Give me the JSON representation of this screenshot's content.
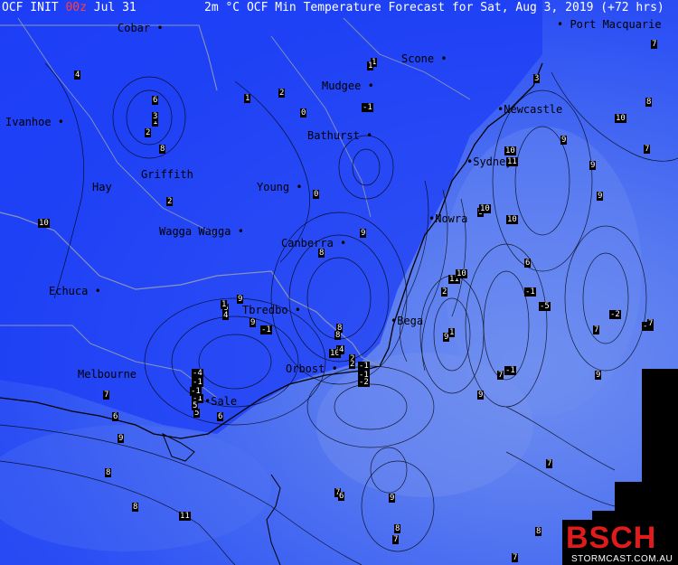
{
  "header": {
    "init_prefix": "OCF INIT ",
    "init_hour": "00z",
    "init_date": " Jul 31",
    "title": "2m °C OCF Min Temperature Forecast for Sat, Aug 3, 2019 (+72 hrs)"
  },
  "cities": [
    {
      "name": "Cobar",
      "label": "Cobar •"
    },
    {
      "name": "Port Macquarie",
      "label": "• Port Macquarie"
    },
    {
      "name": "Scone",
      "label": "Scone •"
    },
    {
      "name": "Mudgee",
      "label": "Mudgee •"
    },
    {
      "name": "Ivanhoe",
      "label": "Ivanhoe •"
    },
    {
      "name": "Newcastle",
      "label": "•Newcastle"
    },
    {
      "name": "Bathurst",
      "label": "Bathurst •"
    },
    {
      "name": "Griffith",
      "label": "Griffith"
    },
    {
      "name": "Sydney",
      "label": "•Sydney"
    },
    {
      "name": "Hay",
      "label": "Hay"
    },
    {
      "name": "Young",
      "label": "Young •"
    },
    {
      "name": "Nowra",
      "label": "•Nowra"
    },
    {
      "name": "Wagga Wagga",
      "label": "Wagga Wagga •"
    },
    {
      "name": "Canberra",
      "label": "Canberra •"
    },
    {
      "name": "Echuca",
      "label": "Echuca •"
    },
    {
      "name": "Tbredbo",
      "label": "Tbredbo •"
    },
    {
      "name": "Bega",
      "label": "•Bega"
    },
    {
      "name": "Orbost",
      "label": "Orbost •"
    },
    {
      "name": "Melbourne",
      "label": "Melbourne"
    },
    {
      "name": "Sale",
      "label": "•Sale"
    }
  ],
  "values": [
    "1",
    "7",
    "4",
    "2",
    "0",
    "1",
    "2",
    "1",
    "-1",
    "8",
    "3",
    "1",
    "2",
    "0",
    "10",
    "9",
    "9",
    "8",
    "11",
    "10",
    "2",
    "-1",
    "9",
    "6",
    "4",
    "9",
    "-1",
    "-3",
    "8",
    "8",
    "9",
    "10",
    "4",
    "2",
    "1",
    "-1",
    "-2",
    "7",
    "-5",
    "-4",
    "-1",
    "0",
    "-1",
    "2",
    "10",
    "10",
    "11",
    "7",
    "7",
    "-1",
    "-1",
    "-2",
    "1",
    "9",
    "9",
    "7",
    "6",
    "6",
    "-1",
    "3",
    "8",
    "5",
    "9",
    "5",
    "6",
    "9",
    "10",
    "10",
    "9",
    "7",
    "6",
    "9",
    "9",
    "8",
    "7",
    "8",
    "9",
    "11",
    "7",
    "6",
    "7",
    "8",
    "8",
    "7"
  ],
  "logo": {
    "main": "BSCH",
    "sub": "STORMCAST.COM.AU"
  }
}
